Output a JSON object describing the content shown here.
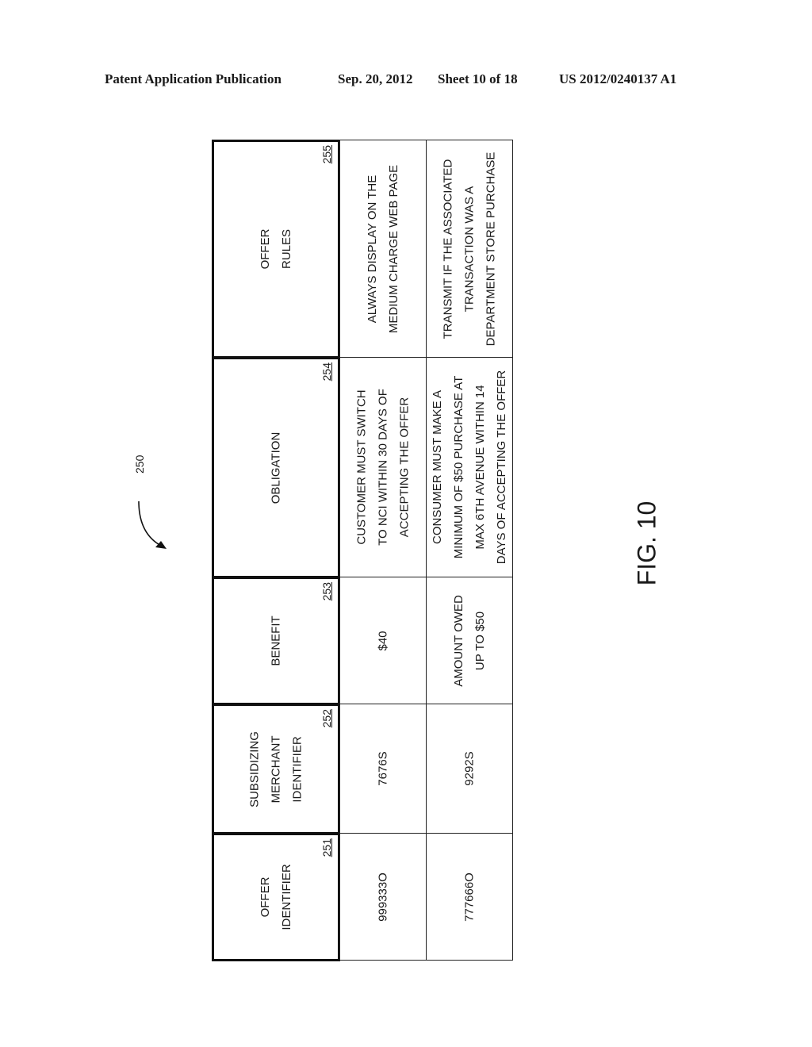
{
  "header": {
    "publication": "Patent Application Publication",
    "date": "Sep. 20, 2012",
    "sheet": "Sheet 10 of 18",
    "number": "US 2012/0240137 A1"
  },
  "figure": {
    "reference": "250",
    "label": "FIG. 10"
  },
  "table": {
    "columns": [
      {
        "label_lines": [
          "OFFER",
          "IDENTIFIER"
        ],
        "ref": "251"
      },
      {
        "label_lines": [
          "SUBSIDIZING",
          "MERCHANT",
          "IDENTIFIER"
        ],
        "ref": "252"
      },
      {
        "label_lines": [
          "BENEFIT"
        ],
        "ref": "253"
      },
      {
        "label_lines": [
          "OBLIGATION"
        ],
        "ref": "254"
      },
      {
        "label_lines": [
          "OFFER",
          "RULES"
        ],
        "ref": "255"
      }
    ],
    "rows": [
      {
        "offer_identifier": "999333O",
        "subsidizing_merchant_identifier": "7676S",
        "benefit": [
          "$40"
        ],
        "obligation": [
          "CUSTOMER MUST SWITCH",
          "TO NCI WITHIN 30 DAYS OF",
          "ACCEPTING THE OFFER"
        ],
        "offer_rules": [
          "ALWAYS DISPLAY ON THE",
          "MEDIUM CHARGE WEB PAGE"
        ]
      },
      {
        "offer_identifier": "777666O",
        "subsidizing_merchant_identifier": "9292S",
        "benefit": [
          "AMOUNT OWED",
          "UP TO $50"
        ],
        "obligation": [
          "CONSUMER MUST MAKE A",
          "MINIMUM OF $50 PURCHASE AT",
          "MAX 6TH AVENUE WITHIN 14",
          "DAYS OF ACCEPTING THE OFFER"
        ],
        "offer_rules": [
          "TRANSMIT IF THE ASSOCIATED",
          "TRANSACTION WAS A",
          "DEPARTMENT STORE PURCHASE"
        ]
      }
    ]
  }
}
